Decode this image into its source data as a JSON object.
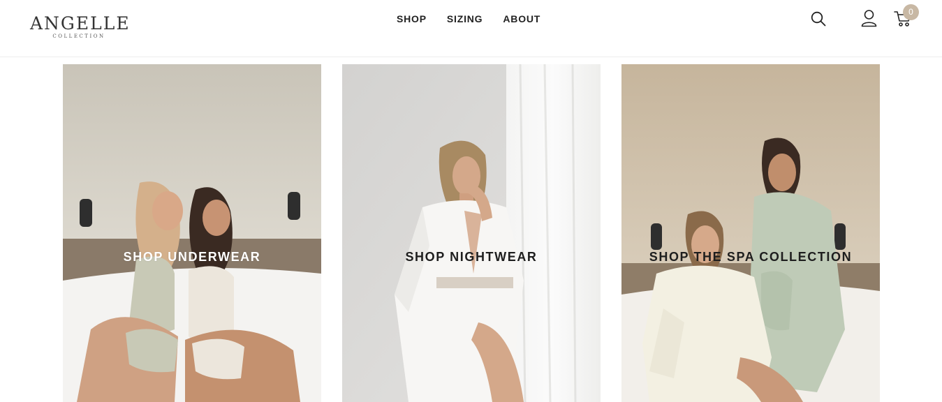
{
  "header": {
    "logo": {
      "name": "ANGELLE",
      "tagline": "COLLECTION"
    },
    "nav": [
      {
        "label": "SHOP"
      },
      {
        "label": "SIZING"
      },
      {
        "label": "ABOUT"
      }
    ],
    "icons": {
      "search": "search-icon",
      "account": "user-icon",
      "cart": "cart-icon"
    },
    "cart_count": "0"
  },
  "collections": [
    {
      "title": "SHOP UNDERWEAR"
    },
    {
      "title": "SHOP NIGHTWEAR"
    },
    {
      "title": "SHOP THE SPA COLLECTION"
    }
  ],
  "colors": {
    "text": "#222222",
    "cart_badge": "#c8b8a4",
    "header_border": "#eeeeee"
  }
}
